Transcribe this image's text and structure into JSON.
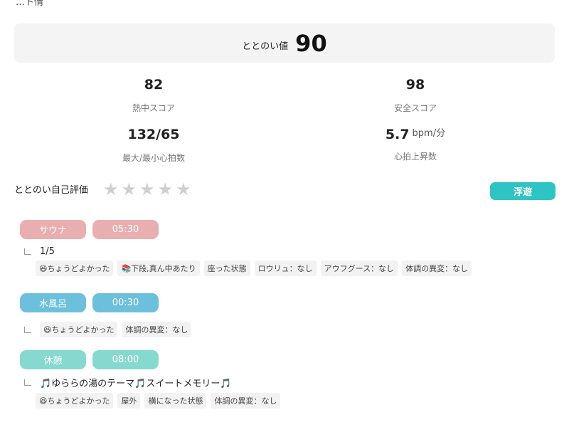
{
  "header": {
    "cut_title": "…ト情"
  },
  "totonoi": {
    "label": "ととのい値",
    "value": "90"
  },
  "stats": {
    "heat_score": {
      "value": "82",
      "label": "熱中スコア"
    },
    "safety_score": {
      "value": "98",
      "label": "安全スコア"
    },
    "heart_rate": {
      "value": "132/65",
      "label": "最大/最小心拍数"
    },
    "hr_rise": {
      "value": "5.7",
      "unit": "bpm/分",
      "label": "心拍上昇数"
    }
  },
  "self_eval": {
    "label": "ととのい自己評価",
    "rating": 0,
    "max": 5,
    "mood": "浮遊"
  },
  "colors": {
    "sauna": "#e9aeb0",
    "water": "#6cc0dc",
    "rest": "#86d9cf",
    "accent": "#2ec4c4"
  },
  "sessions": [
    {
      "type": "サウナ",
      "time": "05:30",
      "note": "1/5",
      "tags": [
        "😆ちょうどよかった",
        "📚下段,真ん中あたり",
        "座った状態",
        "ロウリュ：なし",
        "アウフグース：なし",
        "体調の異変：なし"
      ]
    },
    {
      "type": "水風呂",
      "time": "00:30",
      "tags": [
        "😆ちょうどよかった",
        "体調の異変：なし"
      ]
    },
    {
      "type": "休憩",
      "time": "08:00",
      "note": "🎵ゆららの湯のテーマ🎵スイートメモリー🎵",
      "tags": [
        "😆ちょうどよかった",
        "屋外",
        "横になった状態",
        "体調の異変：なし"
      ]
    }
  ]
}
